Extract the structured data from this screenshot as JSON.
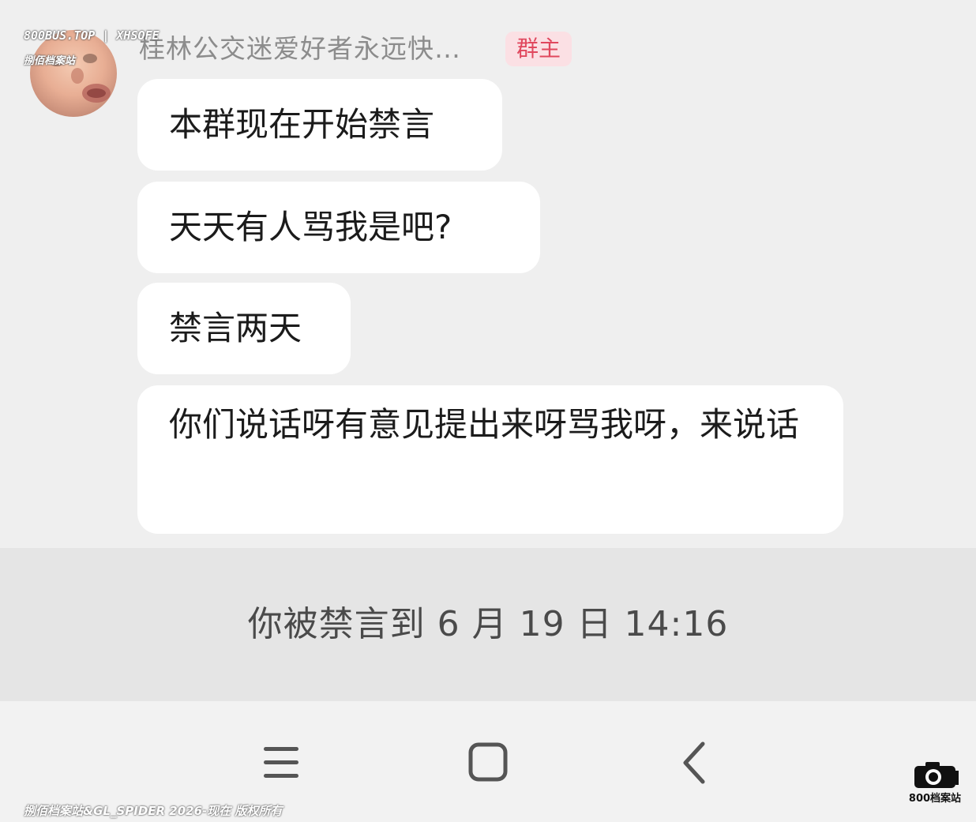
{
  "message": {
    "sender_name": "桂林公交迷爱好者永远快…",
    "role_badge": "群主",
    "bubbles": [
      "本群现在开始禁言",
      "天天有人骂我是吧?",
      "禁言两天",
      "你们说话呀有意见提出来呀骂我呀，来说话"
    ]
  },
  "notice": {
    "text": "你被禁言到 6 月 19 日 14:16"
  },
  "navigation": {
    "menu_icon": "menu-icon",
    "home_icon": "home-icon",
    "back_icon": "back-icon"
  },
  "watermarks": {
    "top_line1": "800BUS.TOP | XHSOFE",
    "top_line2": "捌佰档案站",
    "bottom": "捌佰档案站&GL_SPIDER 2026-现在 版权所有",
    "logo_text": "800档案站"
  },
  "colors": {
    "background": "#efefef",
    "bubble": "#ffffff",
    "notice_band": "#e5e5e5",
    "badge_bg": "#fbe0e4",
    "badge_text": "#e0485e"
  }
}
